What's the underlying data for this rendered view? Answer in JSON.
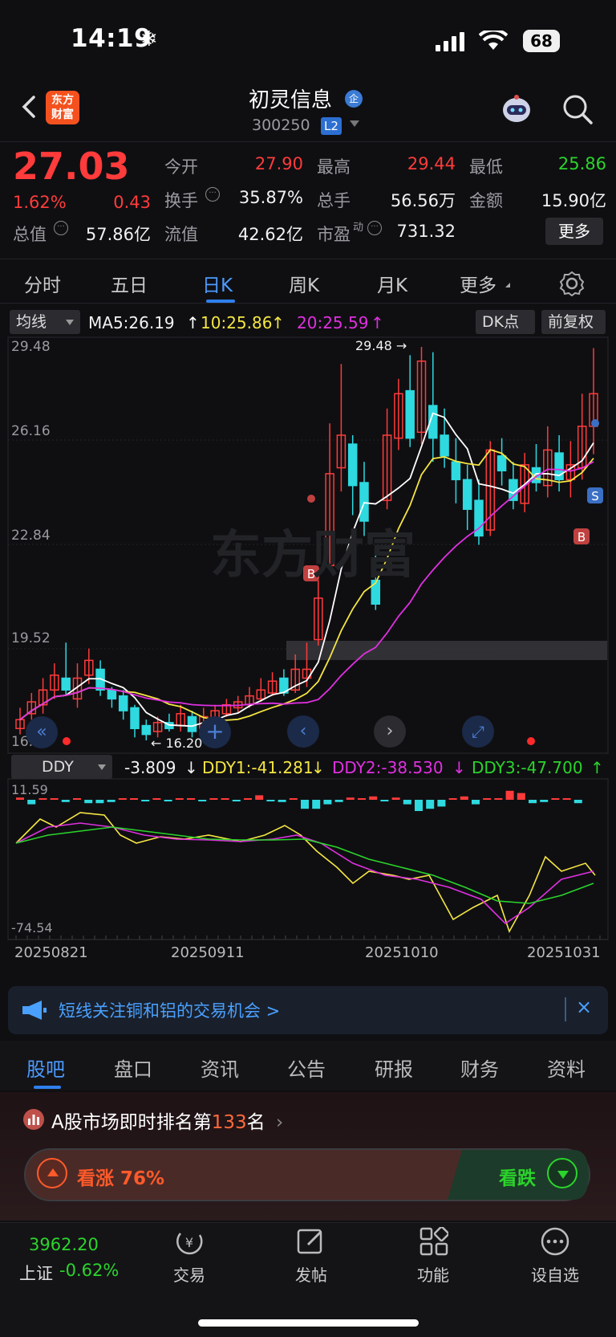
{
  "status_bar": {
    "time": "14:19",
    "battery": "68"
  },
  "header": {
    "logo_text_line1": "东方",
    "logo_text_line2": "财富",
    "stock_name": "初灵信息",
    "enterprise_badge": "企",
    "stock_code": "300250",
    "level_badge": "L2"
  },
  "quote": {
    "price": "27.03",
    "change_pct": "1.62%",
    "change_amt": "0.43",
    "open_label": "今开",
    "open": "27.90",
    "high_label": "最高",
    "high": "29.44",
    "low_label": "最低",
    "low": "25.86",
    "turnover_label": "换手",
    "turnover": "35.87%",
    "volume_label": "总手",
    "volume": "56.56万",
    "amount_label": "金额",
    "amount": "15.90亿",
    "mktcap_label": "总值",
    "mktcap": "57.86亿",
    "float_label": "流值",
    "float_cap": "42.62亿",
    "pe_label": "市盈",
    "pe_sup": "动",
    "pe": "731.32",
    "more_button": "更多"
  },
  "chart_tabs": [
    "分时",
    "五日",
    "日K",
    "周K",
    "月K",
    "更多"
  ],
  "active_tab": "日K",
  "kline": {
    "ma_selector": "均线",
    "ma5": "MA5:26.19",
    "ma10": "10:25.86",
    "ma20": "20:25.59",
    "dk_button": "DK点",
    "adjust_button": "前复权",
    "y_labels": [
      "29.48",
      "26.16",
      "22.84",
      "19.52",
      "16.20"
    ],
    "high_marker": "29.48",
    "low_marker": "16.20",
    "watermark": "东方财富",
    "colors": {
      "up": "#ff3b3b",
      "down": "#2ed9df",
      "ma5": "#ffffff",
      "ma10": "#f5e642",
      "ma20": "#e030e0"
    },
    "signal_markers": [
      "B",
      "B",
      "S"
    ]
  },
  "ddy": {
    "selector": "DDY",
    "value": "-3.809",
    "ddy1": "DDY1:-41.281",
    "ddy2": "DDY2:-38.530",
    "ddy3": "DDY3:-47.700",
    "y_top": "11.59",
    "y_bottom": "-74.54",
    "colors": {
      "ddy1": "#f5e642",
      "ddy2": "#e030e0",
      "ddy3": "#2bd42b"
    }
  },
  "date_axis": [
    "20250821",
    "20250911",
    "20251010",
    "20251031"
  ],
  "banner": {
    "text": "短线关注铜和铝的交易机会 >",
    "close": "×"
  },
  "bottom_tabs": [
    "股吧",
    "盘口",
    "资讯",
    "公告",
    "研报",
    "财务",
    "资料"
  ],
  "ranking": {
    "prefix": "A股市场即时排名第",
    "rank": "133",
    "suffix": "名"
  },
  "vote": {
    "up_label": "看涨 76%",
    "down_label": "看跌"
  },
  "bottom_nav": {
    "index_value": "3962.20",
    "index_name": "上证",
    "index_change": "-0.62%",
    "items": [
      "交易",
      "发帖",
      "功能",
      "设自选"
    ]
  }
}
